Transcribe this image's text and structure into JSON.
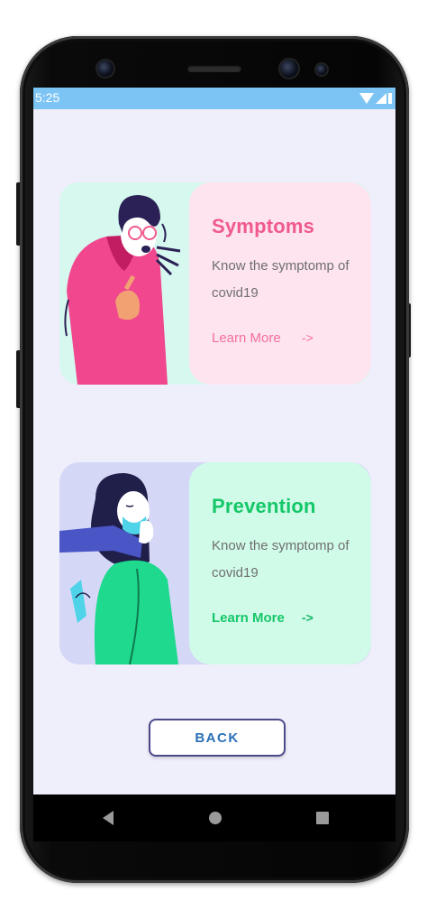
{
  "status_bar": {
    "time": "5:25"
  },
  "cards": [
    {
      "title": "Symptoms",
      "description": "Know the symptomp of covid19",
      "link_label": "Learn More",
      "arrow": "->",
      "illustration": "person-coughing-illustration"
    },
    {
      "title": "Prevention",
      "description": "Know the symptomp of covid19",
      "link_label": "Learn More",
      "arrow": "->",
      "illustration": "person-wearing-mask-illustration"
    }
  ],
  "back_button": {
    "label": "BACK"
  },
  "colors": {
    "screen_bg": "#efeefb",
    "status_bar": "#7cc4f4",
    "symptoms_accent": "#f0598f",
    "prevention_accent": "#14c768",
    "back_text": "#2a70b8"
  },
  "icons": {
    "status": [
      "wifi-icon",
      "signal-icon",
      "battery-icon"
    ],
    "nav": [
      "back-triangle-icon",
      "home-circle-icon",
      "recents-square-icon"
    ]
  }
}
